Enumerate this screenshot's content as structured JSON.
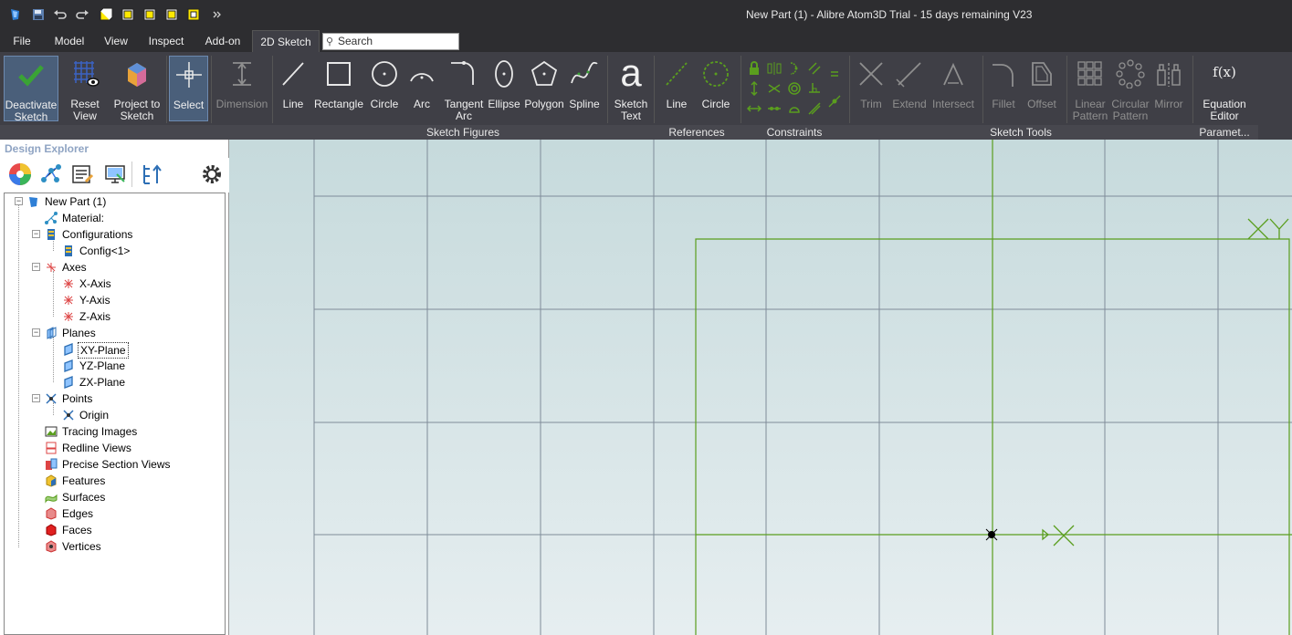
{
  "app": {
    "title": "New Part (1) - Alibre Atom3D  Trial - 15 days remaining V23"
  },
  "menu": {
    "tabs": [
      "File",
      "Model",
      "View",
      "Inspect",
      "Add-on",
      "2D Sketch"
    ],
    "active_tab": "2D Sketch",
    "search_placeholder": "Search"
  },
  "ribbon": {
    "deactivate": "Deactivate Sketch",
    "reset_view": "Reset View",
    "project": "Project to Sketch",
    "select": "Select",
    "dimension": "Dimension",
    "line": "Line",
    "rectangle": "Rectangle",
    "circle": "Circle",
    "arc": "Arc",
    "tangent_arc": "Tangent Arc",
    "ellipse": "Ellipse",
    "polygon": "Polygon",
    "spline": "Spline",
    "sketch_text": "Sketch Text",
    "ref_line": "Line",
    "ref_circle": "Circle",
    "trim": "Trim",
    "extend": "Extend",
    "intersect": "Intersect",
    "fillet": "Fillet",
    "offset": "Offset",
    "linear_pattern": "Linear Pattern",
    "circular_pattern": "Circular Pattern",
    "mirror": "Mirror",
    "equation_editor": "Equation Editor",
    "equation_glyph": "f(x)",
    "text_glyph": "a",
    "groups": {
      "sketch_figures": "Sketch Figures",
      "references": "References",
      "constraints": "Constraints",
      "sketch_tools": "Sketch Tools",
      "parameters": "Paramet..."
    }
  },
  "explorer": {
    "title": "Design Explorer",
    "tree": {
      "root": "New Part (1)",
      "material": "Material:",
      "configurations": "Configurations",
      "config1": "Config<1>",
      "axes": "Axes",
      "x_axis": "X-Axis",
      "y_axis": "Y-Axis",
      "z_axis": "Z-Axis",
      "planes": "Planes",
      "xy_plane": "XY-Plane",
      "yz_plane": "YZ-Plane",
      "zx_plane": "ZX-Plane",
      "points": "Points",
      "origin": "Origin",
      "tracing_images": "Tracing Images",
      "redline_views": "Redline Views",
      "precise_section_views": "Precise Section Views",
      "features": "Features",
      "surfaces": "Surfaces",
      "edges": "Edges",
      "faces": "Faces",
      "vertices": "Vertices"
    }
  },
  "colors": {
    "sketch_green": "#5a9e1e",
    "grid": "#7f8c99",
    "accent": "#4a5f7a"
  }
}
